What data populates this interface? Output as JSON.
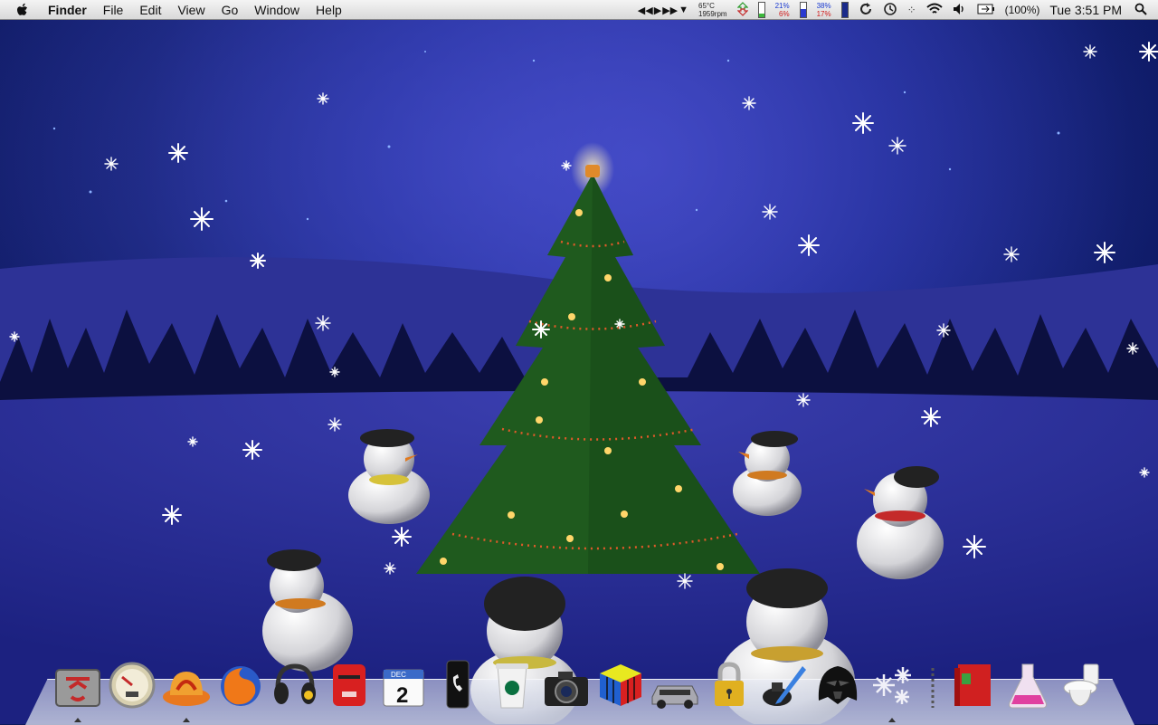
{
  "menubar": {
    "app_name": "Finder",
    "menus": [
      "File",
      "Edit",
      "View",
      "Go",
      "Window",
      "Help"
    ],
    "status": {
      "temp": "65°C",
      "rpm": "1959rpm",
      "cpu_user": "21%",
      "cpu_sys": "6%",
      "mem_user": "38%",
      "mem_sys": "17%",
      "battery": "(100%)",
      "clock": "Tue 3:51 PM"
    }
  },
  "dock": {
    "items": [
      {
        "icon": "finder-icon",
        "running": true
      },
      {
        "icon": "dashboard-gauge-icon",
        "running": false
      },
      {
        "icon": "fire-hat-icon",
        "running": true
      },
      {
        "icon": "firefox-icon",
        "running": false
      },
      {
        "icon": "itunes-headphones-icon",
        "running": false
      },
      {
        "icon": "mailbox-icon",
        "running": false
      },
      {
        "icon": "ical-icon",
        "running": false,
        "month": "DEC",
        "day": "2"
      },
      {
        "icon": "phone-icon",
        "running": false
      },
      {
        "icon": "starbucks-cup-icon",
        "running": false
      },
      {
        "icon": "camera-icon",
        "running": false
      },
      {
        "icon": "rubiks-cube-icon",
        "running": false
      },
      {
        "icon": "delorean-icon",
        "running": false
      },
      {
        "icon": "padlock-icon",
        "running": false
      },
      {
        "icon": "ink-pen-icon",
        "running": false
      },
      {
        "icon": "darth-vader-icon",
        "running": false
      },
      {
        "icon": "snowflakes-icon",
        "running": true
      },
      {
        "icon": "dock-separator",
        "running": false
      },
      {
        "icon": "red-book-icon",
        "running": false
      },
      {
        "icon": "pink-flask-icon",
        "running": false
      },
      {
        "icon": "trash-toilet-icon",
        "running": false
      }
    ]
  },
  "colors": {
    "sky_top": "#081250",
    "aurora": "#3a3fb8",
    "tree_green": "#1f5a1e",
    "snow_ground": "#2a2f9c",
    "menubar": "#e8e8e8"
  }
}
